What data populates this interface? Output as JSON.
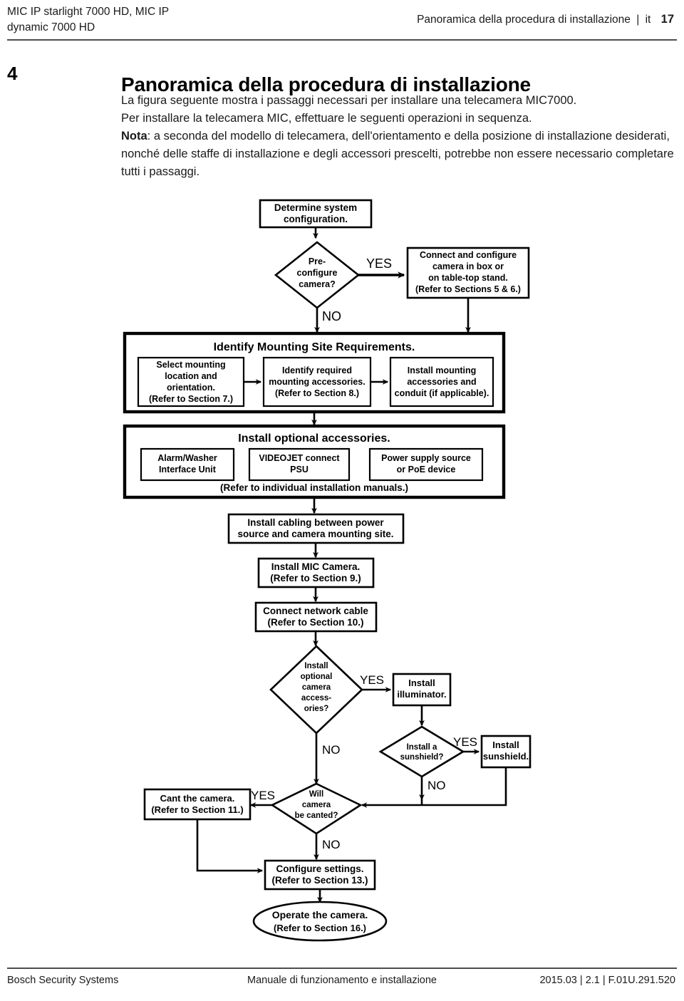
{
  "header": {
    "product_line1": "MIC IP starlight 7000 HD, MIC IP",
    "product_line2": "dynamic 7000 HD",
    "section_title": "Panoramica della procedura di installazione",
    "separator": "|",
    "language": "it",
    "page_number": "17"
  },
  "chapter": {
    "number": "4",
    "title": "Panoramica della procedura di installazione"
  },
  "intro": {
    "line1": "La figura seguente mostra i passaggi necessari per installare una telecamera MIC7000.",
    "line2": "Per installare la telecamera MIC, effettuare le seguenti operazioni in sequenza.",
    "nota_label": "Nota",
    "nota_body": ": a seconda del modello di telecamera, dell'orientamento e della posizione di installazione desiderati, nonché delle staffe di installazione e degli accessori prescelti, potrebbe non essere necessario completare tutti i passaggi."
  },
  "flowchart": {
    "nodes": {
      "determine_config": {
        "shape": "box",
        "lines": [
          "Determine system",
          "configuration."
        ]
      },
      "preconfigure_camera": {
        "shape": "diamond",
        "lines": [
          "Pre-",
          "configure",
          "camera?"
        ]
      },
      "connect_configure": {
        "shape": "box",
        "lines": [
          "Connect and configure",
          "camera in box or",
          "on table-top stand.",
          "(Refer to Sections 5 & 6.)"
        ]
      },
      "mounting_site_group": {
        "shape": "group",
        "title": "Identify Mounting Site Requirements."
      },
      "select_location": {
        "shape": "box",
        "lines": [
          "Select mounting",
          "location and",
          "orientation.",
          "(Refer to Section 7.)"
        ]
      },
      "identify_accessories": {
        "shape": "box",
        "lines": [
          "Identify required",
          "mounting accessories.",
          "(Refer to Section 8.)"
        ]
      },
      "install_mounting": {
        "shape": "box",
        "lines": [
          "Install mounting",
          "accessories and",
          "conduit (if applicable)."
        ]
      },
      "optional_accessories_group": {
        "shape": "group",
        "title": "Install optional accessories.",
        "footnote": "(Refer to individual installation manuals.)"
      },
      "alarm_washer": {
        "shape": "box",
        "lines": [
          "Alarm/Washer",
          "Interface Unit"
        ]
      },
      "videojet_psu": {
        "shape": "box",
        "lines": [
          "VIDEOJET connect",
          "PSU"
        ]
      },
      "power_supply": {
        "shape": "box",
        "lines": [
          "Power supply source",
          "or PoE device"
        ]
      },
      "install_cabling": {
        "shape": "box",
        "lines": [
          "Install cabling between power",
          "source and camera mounting site."
        ]
      },
      "install_mic_camera": {
        "shape": "box",
        "lines": [
          "Install MIC Camera.",
          "(Refer to Section 9.)"
        ]
      },
      "connect_network_cable": {
        "shape": "box",
        "lines": [
          "Connect network cable",
          "(Refer to Section 10.)"
        ]
      },
      "optional_camera_accessories": {
        "shape": "diamond",
        "lines": [
          "Install",
          "optional",
          "camera",
          "access-",
          "ories?"
        ]
      },
      "install_illuminator": {
        "shape": "box",
        "lines": [
          "Install",
          "illuminator."
        ]
      },
      "install_sunshield_q": {
        "shape": "diamond",
        "lines": [
          "Install a",
          "sunshield?"
        ]
      },
      "install_sunshield": {
        "shape": "box",
        "lines": [
          "Install",
          "sunshield."
        ]
      },
      "will_camera_be_canted": {
        "shape": "diamond",
        "lines": [
          "Will",
          "camera",
          "be canted?"
        ]
      },
      "cant_the_camera": {
        "shape": "box",
        "lines": [
          "Cant the camera.",
          "(Refer to Section 11.)"
        ]
      },
      "configure_settings": {
        "shape": "box",
        "lines": [
          "Configure settings.",
          "(Refer to Section 13.)"
        ]
      },
      "operate_camera": {
        "shape": "ellipse",
        "lines": [
          "Operate the camera.",
          "(Refer to Section 16.)"
        ]
      }
    },
    "edge_labels": {
      "preconfigure_yes": "YES",
      "preconfigure_no": "NO",
      "accessories_yes": "YES",
      "accessories_no": "NO",
      "sunshield_yes": "YES",
      "sunshield_no": "NO",
      "canted_yes": "YES",
      "canted_no": "NO"
    }
  },
  "footer": {
    "left": "Bosch Security Systems",
    "center": "Manuale di funzionamento e installazione",
    "right": "2015.03 | 2.1 | F.01U.291.520"
  },
  "colors": {
    "text": "#1a1a1a",
    "rule": "#4d4d4d",
    "stroke": "#000000",
    "background": "#ffffff"
  }
}
